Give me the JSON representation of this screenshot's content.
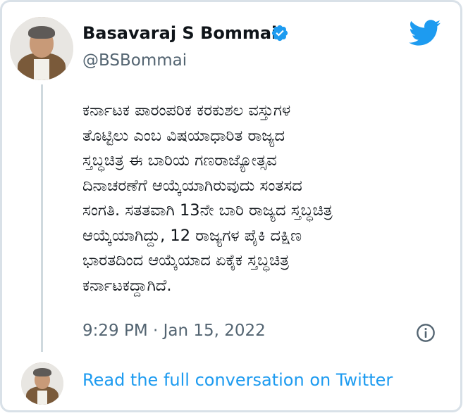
{
  "author": {
    "name": "Basavaraj S Bommai",
    "handle": "@BSBommai",
    "verified": true,
    "avatar": "profile-photo"
  },
  "tweet": {
    "text": "ಕರ್ನಾಟಕ ಪಾರಂಪರಿಕ ಕರಕುಶಲ ವಸ್ತುಗಳ\nತೊಟ್ಟಿಲು ಎಂಬ ವಿಷಯಾಧಾರಿತ ರಾಜ್ಯದ\nಸ್ತಬ್ಧಚಿತ್ರ ಈ ಬಾರಿಯ ಗಣರಾಜ್ಯೋತ್ಸವ\nದಿನಾಚರಣೆಗೆ ಆಯ್ಕೆಯಾಗಿರುವುದು ಸಂತಸದ\nಸಂಗತಿ. ಸತತವಾಗಿ 13ನೇ ಬಾರಿ ರಾಜ್ಯದ ಸ್ತಬ್ಧಚಿತ್ರ\nಆಯ್ಕೆಯಾಗಿದ್ದು, 12 ರಾಜ್ಯಗಳ ಪೈಕಿ ದಕ್ಷಿಣ\nಭಾರತದಿಂದ ಆಯ್ಕೆಯಾದ ಏಕೈಕ ಸ್ತಬ್ಧಚಿತ್ರ\nಕರ್ನಾಟಕದ್ದಾಗಿದೆ.",
    "timestamp": "9:29 PM · Jan 15, 2022"
  },
  "footer": {
    "link_label": "Read the full conversation on Twitter"
  },
  "icons": {
    "brand": "twitter-bird-icon",
    "verified": "verified-badge-icon",
    "info": "info-icon"
  },
  "colors": {
    "brand_blue": "#1d9bf0",
    "text_primary": "#0f1419",
    "text_secondary": "#536471",
    "border": "#d9e1e8"
  }
}
